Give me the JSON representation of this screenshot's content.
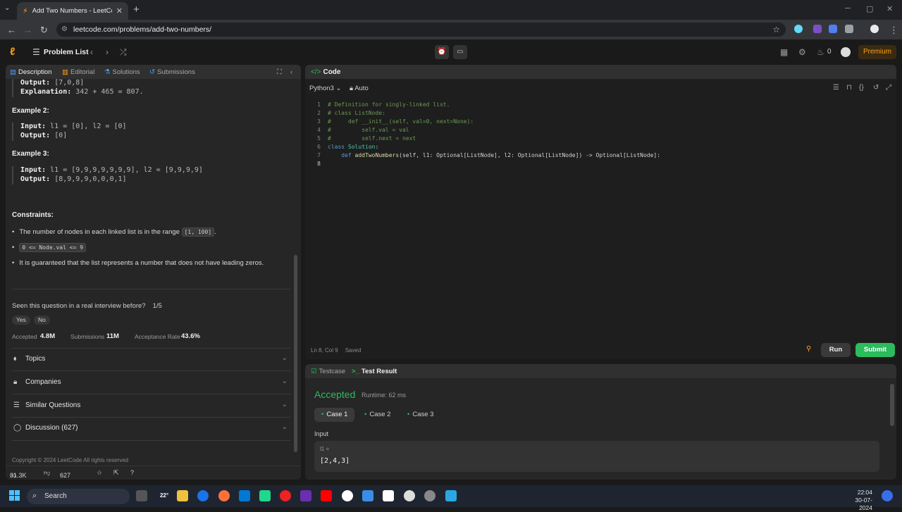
{
  "browser": {
    "tab_title": "Add Two Numbers - LeetCode",
    "url": "leetcode.com/problems/add-two-numbers/"
  },
  "nav": {
    "problem_list": "Problem List",
    "streak_count": "0",
    "premium": "Premium"
  },
  "left_tabs": [
    {
      "label": "Description"
    },
    {
      "label": "Editorial"
    },
    {
      "label": "Solutions"
    },
    {
      "label": "Submissions"
    }
  ],
  "examples": {
    "ex1_output_label": "Output:",
    "ex1_output": "[7,0,8]",
    "ex1_explanation_label": "Explanation:",
    "ex1_explanation": "342 + 465 = 807.",
    "ex2_title": "Example 2:",
    "ex2_input_label": "Input:",
    "ex2_input": "l1 = [0], l2 = [0]",
    "ex2_output_label": "Output:",
    "ex2_output": "[0]",
    "ex3_title": "Example 3:",
    "ex3_input_label": "Input:",
    "ex3_input": "l1 = [9,9,9,9,9,9,9], l2 = [9,9,9,9]",
    "ex3_output_label": "Output:",
    "ex3_output": "[8,9,9,9,0,0,0,1]"
  },
  "constraints": {
    "title": "Constraints:",
    "c1_text": "The number of nodes in each linked list is in the range",
    "c1_code": "[1, 100]",
    "c1_end": ".",
    "c2_code": "0 <= Node.val <= 9",
    "c3_text": "It is guaranteed that the list represents a number that does not have leading zeros."
  },
  "interview": {
    "question": "Seen this question in a real interview before?",
    "progress": "1/5",
    "yes": "Yes",
    "no": "No"
  },
  "stats": {
    "accepted_label": "Accepted",
    "accepted_value": "4.8M",
    "submissions_label": "Submissions",
    "submissions_value": "11M",
    "rate_label": "Acceptance Rate",
    "rate_value": "43.6%"
  },
  "accordions": [
    {
      "label": "Topics"
    },
    {
      "label": "Companies"
    },
    {
      "label": "Similar Questions"
    },
    {
      "label": "Discussion (627)"
    }
  ],
  "footer": {
    "copyright": "Copyright © 2024 LeetCode All rights reserved",
    "likes": "31.3K",
    "comments": "627"
  },
  "code_panel": {
    "title": "Code",
    "language": "Python3",
    "mode": "Auto",
    "status_pos": "Ln 8, Col 9",
    "status_saved": "Saved",
    "run": "Run",
    "submit": "Submit"
  },
  "code_lines": [
    "1",
    "2",
    "3",
    "4",
    "5",
    "6",
    "7",
    "8"
  ],
  "code": {
    "l1": "# Definition for singly-linked list.",
    "l2": "# class ListNode:",
    "l3": "#     def __init__(self, val=0, next=None):",
    "l4": "#         self.val = val",
    "l5": "#         self.next = next",
    "l6_kw": "class",
    "l6_name": "Solution",
    "l6_end": ":",
    "l7_kw": "def",
    "l7_fn": "addTwoNumbers",
    "l7_rest": "(self, l1: Optional[ListNode], l2: Optional[ListNode]) -> Optional[ListNode]:"
  },
  "result": {
    "testcase_tab": "Testcase",
    "result_tab": "Test Result",
    "status": "Accepted",
    "runtime": "Runtime: 62 ms",
    "cases": [
      "Case 1",
      "Case 2",
      "Case 3"
    ],
    "input_label": "Input",
    "var_name": "l1 =",
    "var_value": "[2,4,3]"
  },
  "taskbar": {
    "search": "Search",
    "weather": "22°",
    "time": "22:04",
    "date": "30-07-2024"
  }
}
